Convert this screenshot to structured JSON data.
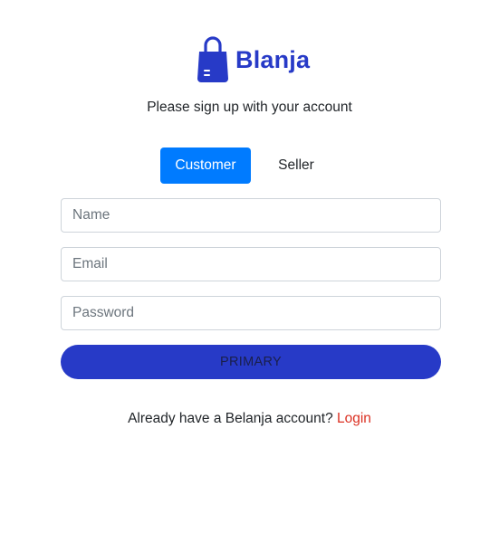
{
  "brand": {
    "name": "Blanja",
    "icon": "shopping-bag-icon",
    "color": "#273ac7"
  },
  "subtitle": "Please sign up with your account",
  "role_toggle": {
    "customer_label": "Customer",
    "seller_label": "Seller",
    "selected": "Customer",
    "active_color": "#007bff"
  },
  "form": {
    "name_placeholder": "Name",
    "email_placeholder": "Email",
    "password_placeholder": "Password",
    "submit_label": "PRIMARY"
  },
  "footer": {
    "prompt": "Already have a Belanja account? ",
    "login_label": "Login",
    "link_color": "#db3022"
  }
}
